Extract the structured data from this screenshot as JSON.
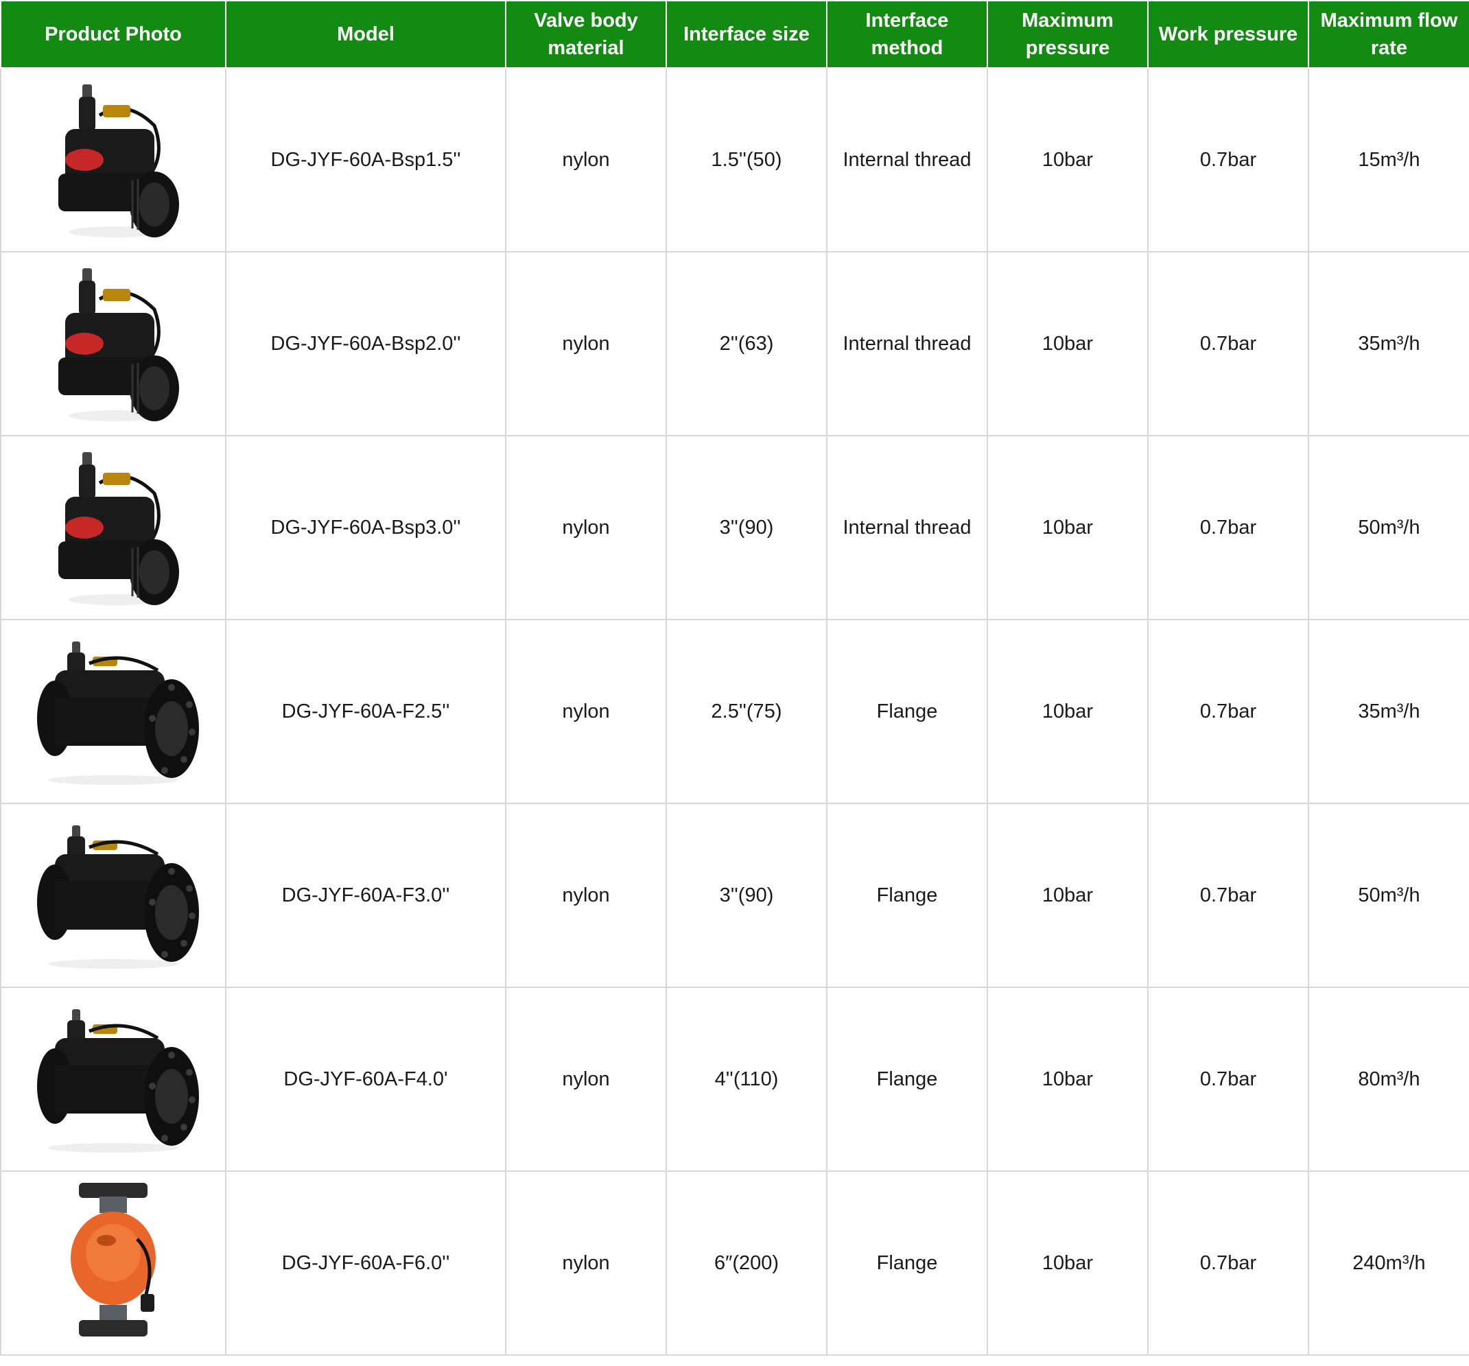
{
  "table": {
    "headers": [
      "Product Photo",
      "Model",
      "Valve body\nmaterial",
      "Interface size",
      "Interface\nmethod",
      "Maximum\npressure",
      "Work pressure",
      "Maximum flow\nrate"
    ],
    "header_color": "#138b12",
    "rows": [
      {
        "photo": "valve-threaded-photo",
        "model": "DG-JYF-60A-Bsp1.5''",
        "material": "nylon",
        "size": "1.5''(50)",
        "method": "Internal thread",
        "max_pressure": "10bar",
        "work_pressure": "0.7bar",
        "flow": "15m³/h"
      },
      {
        "photo": "valve-threaded-photo",
        "model": "DG-JYF-60A-Bsp2.0''",
        "material": "nylon",
        "size": "2''(63)",
        "method": "Internal thread",
        "max_pressure": "10bar",
        "work_pressure": "0.7bar",
        "flow": "35m³/h"
      },
      {
        "photo": "valve-threaded-photo",
        "model": "DG-JYF-60A-Bsp3.0''",
        "material": "nylon",
        "size": "3''(90)",
        "method": "Internal thread",
        "max_pressure": "10bar",
        "work_pressure": "0.7bar",
        "flow": "50m³/h"
      },
      {
        "photo": "valve-flange-photo",
        "model": "DG-JYF-60A-F2.5''",
        "material": "nylon",
        "size": "2.5''(75)",
        "method": "Flange",
        "max_pressure": "10bar",
        "work_pressure": "0.7bar",
        "flow": "35m³/h"
      },
      {
        "photo": "valve-flange-photo",
        "model": "DG-JYF-60A-F3.0''",
        "material": "nylon",
        "size": "3''(90)",
        "method": "Flange",
        "max_pressure": "10bar",
        "work_pressure": "0.7bar",
        "flow": "50m³/h"
      },
      {
        "photo": "valve-flange-photo",
        "model": "DG-JYF-60A-F4.0'",
        "material": "nylon",
        "size": "4''(110)",
        "method": "Flange",
        "max_pressure": "10bar",
        "work_pressure": "0.7bar",
        "flow": "80m³/h"
      },
      {
        "photo": "valve-orange-photo",
        "model": "DG-JYF-60A-F6.0''",
        "material": "nylon",
        "size": "6″(200)",
        "method": "Flange",
        "max_pressure": "10bar",
        "work_pressure": "0.7bar",
        "flow": "240m³/h"
      }
    ]
  }
}
